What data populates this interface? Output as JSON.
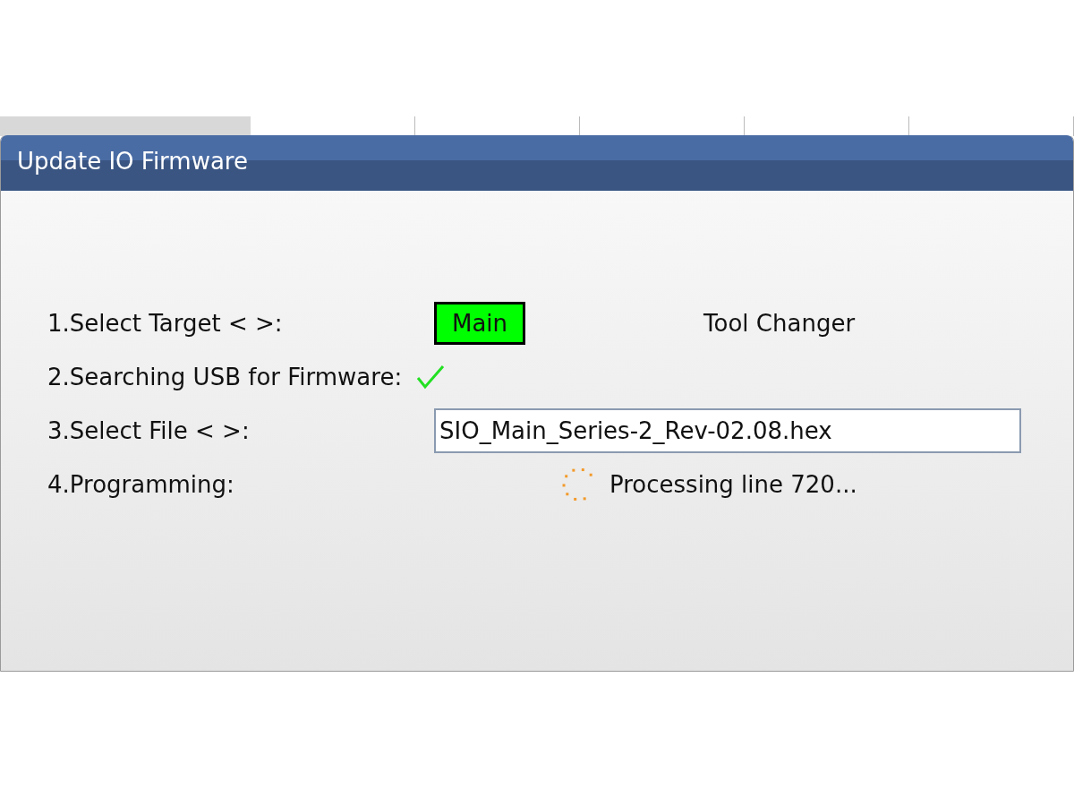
{
  "window": {
    "title": "Update IO Firmware"
  },
  "steps": [
    {
      "kind": "target",
      "label": "1.Select Target < >:",
      "options": [
        {
          "label": "Main",
          "selected": true
        },
        {
          "label": "Tool Changer",
          "selected": false
        }
      ]
    },
    {
      "kind": "check",
      "label": "2.Searching USB for Firmware:",
      "done": true
    },
    {
      "kind": "file",
      "label": "3.Select File < >:",
      "value": "SIO_Main_Series-2_Rev-02.08.hex"
    },
    {
      "kind": "progress",
      "label": "4.Programming:",
      "status": "Processing line 720..."
    }
  ]
}
